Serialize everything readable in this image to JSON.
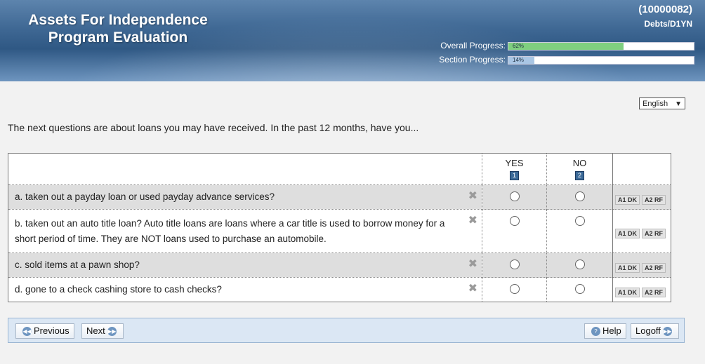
{
  "header": {
    "title_line1": "Assets For Independence",
    "title_line2": "Program Evaluation",
    "case_id": "(10000082)",
    "section_code": "Debts/D1YN",
    "overall_label": "Overall Progress:",
    "overall_value": "62%",
    "overall_fraction": 0.62,
    "section_label": "Section Progress:",
    "section_value": "14%",
    "section_fraction": 0.14
  },
  "language": {
    "selected": "English"
  },
  "intro": "The next questions are about loans you may have received. In the past 12 months, have you...",
  "columns": [
    {
      "label": "YES",
      "code": "1"
    },
    {
      "label": "NO",
      "code": "2"
    }
  ],
  "questions": [
    {
      "text": "a. taken out a payday loan or used payday advance services?"
    },
    {
      "text": "b. taken out an auto title loan?   Auto title loans are loans where a car title is used to borrow money for a short period of time. They are NOT loans used to purchase an automobile."
    },
    {
      "text": "c. sold items at a pawn shop?"
    },
    {
      "text": "d. gone to a check cashing store to cash checks?"
    }
  ],
  "dk_label": "A1 DK",
  "rf_label": "A2 RF",
  "nav": {
    "previous": "Previous",
    "next": "Next",
    "help": "Help",
    "logoff": "Logoff"
  },
  "colors": {
    "header": "#3f6894",
    "overall_fill": "#7fcf7f",
    "section_fill": "#a9c6e4"
  }
}
